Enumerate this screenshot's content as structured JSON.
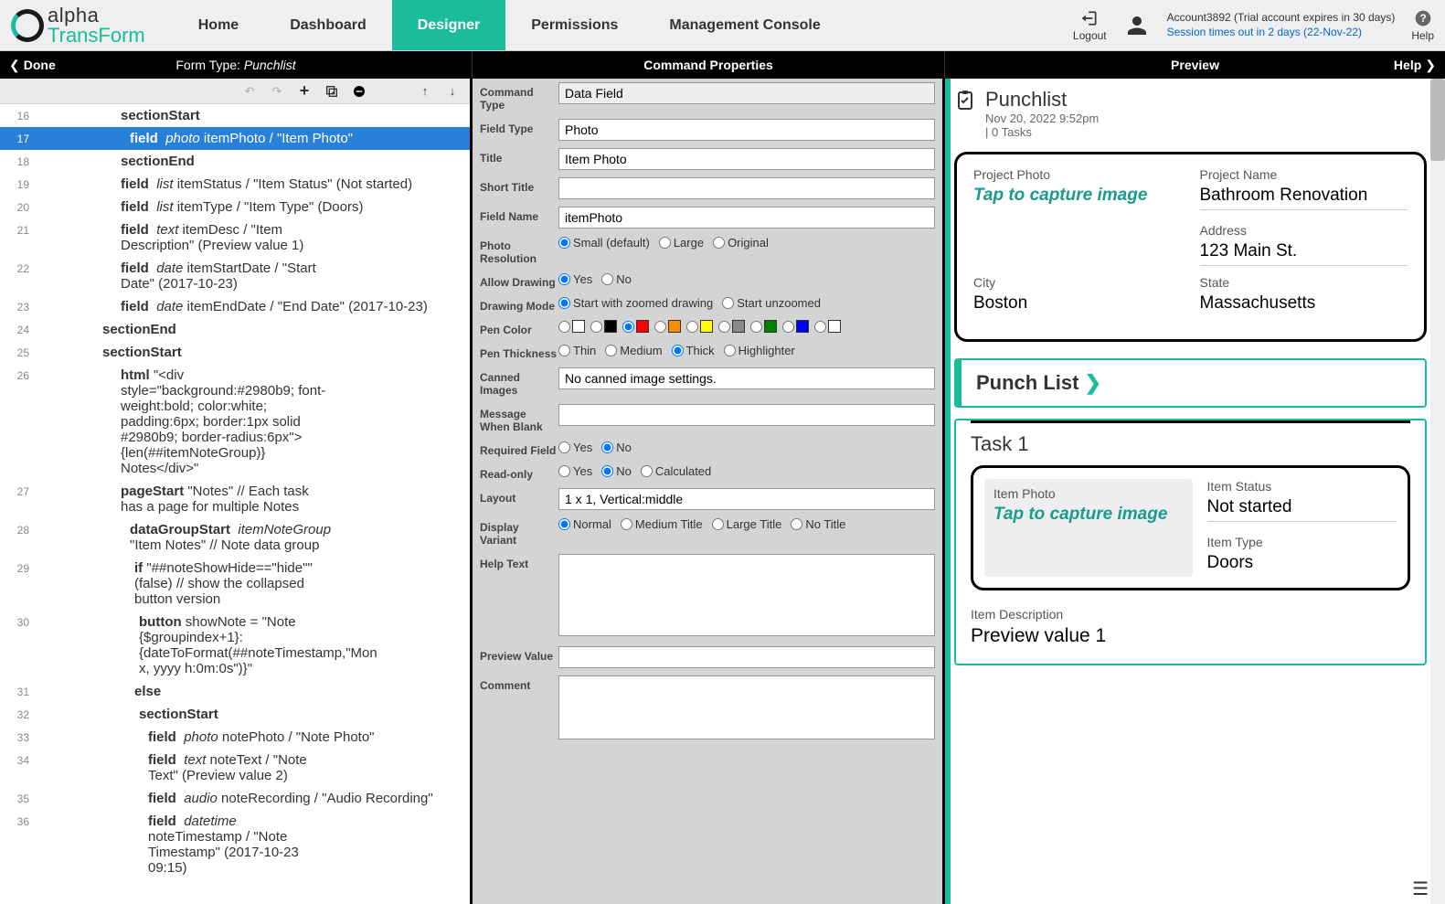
{
  "header": {
    "nav": {
      "home": "Home",
      "dashboard": "Dashboard",
      "designer": "Designer",
      "permissions": "Permissions",
      "console": "Management Console"
    },
    "logout": "Logout",
    "help": "Help",
    "account_line": "Account3892 (Trial account expires in 30 days)",
    "session_line": "Session times out in 2 days (22-Nov-22)"
  },
  "subbar": {
    "done": "Done",
    "form_type_label": "Form Type: ",
    "form_type_value": "Punchlist",
    "props_title": "Command Properties",
    "preview_title": "Preview",
    "help": "Help"
  },
  "lines": {
    "l16": {
      "n": "16",
      "kw": "sectionStart"
    },
    "l17": {
      "n": "17",
      "kw": "field",
      "ty": "photo",
      "rest": " itemPhoto / \"Item Photo\""
    },
    "l18": {
      "n": "18",
      "kw": "sectionEnd"
    },
    "l19": {
      "n": "19",
      "kw": "field",
      "ty": "list",
      "rest": " itemStatus / \"Item Status\" (Not started)"
    },
    "l20": {
      "n": "20",
      "kw": "field",
      "ty": "list",
      "rest": " itemType / \"Item Type\" (Doors)"
    },
    "l21": {
      "n": "21",
      "kw": "field",
      "ty": "text",
      "rest": " itemDesc / \"Item Description\" (Preview value 1)"
    },
    "l22": {
      "n": "22",
      "kw": "field",
      "ty": "date",
      "rest": " itemStartDate / \"Start Date\" (2017-10-23)"
    },
    "l23": {
      "n": "23",
      "kw": "field",
      "ty": "date",
      "rest": " itemEndDate / \"End Date\" (2017-10-23)"
    },
    "l24": {
      "n": "24",
      "kw": "sectionEnd"
    },
    "l25": {
      "n": "25",
      "kw": "sectionStart"
    },
    "l26": {
      "n": "26",
      "kw": "html",
      "rest": " \"<div style=\"background:#2980b9; font-weight:bold; color:white; padding:6px; border:1px solid #2980b9; border-radius:6px\">{len(##itemNoteGroup)} Notes</div>\""
    },
    "l27": {
      "n": "27",
      "kw": "pageStart",
      "rest": " \"Notes\" // Each task has a page for multiple Notes"
    },
    "l28": {
      "n": "28",
      "kw": "dataGroupStart",
      "ty": "itemNoteGroup",
      "rest": " \"Item Notes\" // Note data group"
    },
    "l29": {
      "n": "29",
      "kw": "if",
      "rest": " \"##noteShowHide==\"hide\"\" (false) // show the collapsed button version"
    },
    "l30": {
      "n": "30",
      "kw": "button",
      "rest": " showNote = \"Note {$groupindex+1}: {dateToFormat(##noteTimestamp,\"Mon x, yyyy h:0m:0s\")}\""
    },
    "l31": {
      "n": "31",
      "kw": "else"
    },
    "l32": {
      "n": "32",
      "kw": "sectionStart"
    },
    "l33": {
      "n": "33",
      "kw": "field",
      "ty": "photo",
      "rest": " notePhoto / \"Note Photo\""
    },
    "l34": {
      "n": "34",
      "kw": "field",
      "ty": "text",
      "rest": " noteText / \"Note Text\" (Preview value 2)"
    },
    "l35": {
      "n": "35",
      "kw": "field",
      "ty": "audio",
      "rest": " noteRecording / \"Audio Recording\""
    },
    "l36": {
      "n": "36",
      "kw": "field",
      "ty": "datetime",
      "rest": " noteTimestamp / \"Note Timestamp\" (2017-10-23 09:15)"
    }
  },
  "props": {
    "command_type_label": "Command Type",
    "command_type": "Data Field",
    "field_type_label": "Field Type",
    "field_type": "Photo",
    "title_label": "Title",
    "title": "Item Photo",
    "short_title_label": "Short Title",
    "short_title": "",
    "field_name_label": "Field Name",
    "field_name": "itemPhoto",
    "photo_res_label": "Photo Resolution",
    "res_small": "Small (default)",
    "res_large": "Large",
    "res_original": "Original",
    "allow_drawing_label": "Allow Drawing",
    "yes": "Yes",
    "no": "No",
    "drawing_mode_label": "Drawing Mode",
    "dm_zoom": "Start with zoomed drawing",
    "dm_unzoom": "Start unzoomed",
    "pen_color_label": "Pen Color",
    "pen_thick_label": "Pen Thickness",
    "pt_thin": "Thin",
    "pt_med": "Medium",
    "pt_thick": "Thick",
    "pt_hl": "Highlighter",
    "canned_label": "Canned Images",
    "canned": "No canned image settings.",
    "msg_blank_label": "Message When Blank",
    "msg_blank": "",
    "required_label": "Required Field",
    "readonly_label": "Read-only",
    "ro_calc": "Calculated",
    "layout_label": "Layout",
    "layout": "1 x 1, Vertical:middle",
    "display_variant_label": "Display Variant",
    "dv_normal": "Normal",
    "dv_medtitle": "Medium Title",
    "dv_lgtitle": "Large Title",
    "dv_notitle": "No Title",
    "help_text_label": "Help Text",
    "help_text": "",
    "preview_value_label": "Preview Value",
    "preview_value": "",
    "comment_label": "Comment",
    "comment": ""
  },
  "preview": {
    "title": "Punchlist",
    "date": "Nov 20, 2022 9:52pm",
    "tasks": "| 0 Tasks",
    "project_photo_label": "Project Photo",
    "tap_capture": "Tap to capture image",
    "project_name_label": "Project Name",
    "project_name": "Bathroom Renovation",
    "address_label": "Address",
    "address": "123 Main St.",
    "city_label": "City",
    "city": "Boston",
    "state_label": "State",
    "state": "Massachusetts",
    "punchlist_label": "Punch List ",
    "task1_title": "Task 1",
    "item_photo_label": "Item Photo",
    "item_status_label": "Item Status",
    "item_status": "Not started",
    "item_type_label": "Item Type",
    "item_type": "Doors",
    "item_desc_label": "Item Description",
    "item_desc": "Preview value 1"
  }
}
